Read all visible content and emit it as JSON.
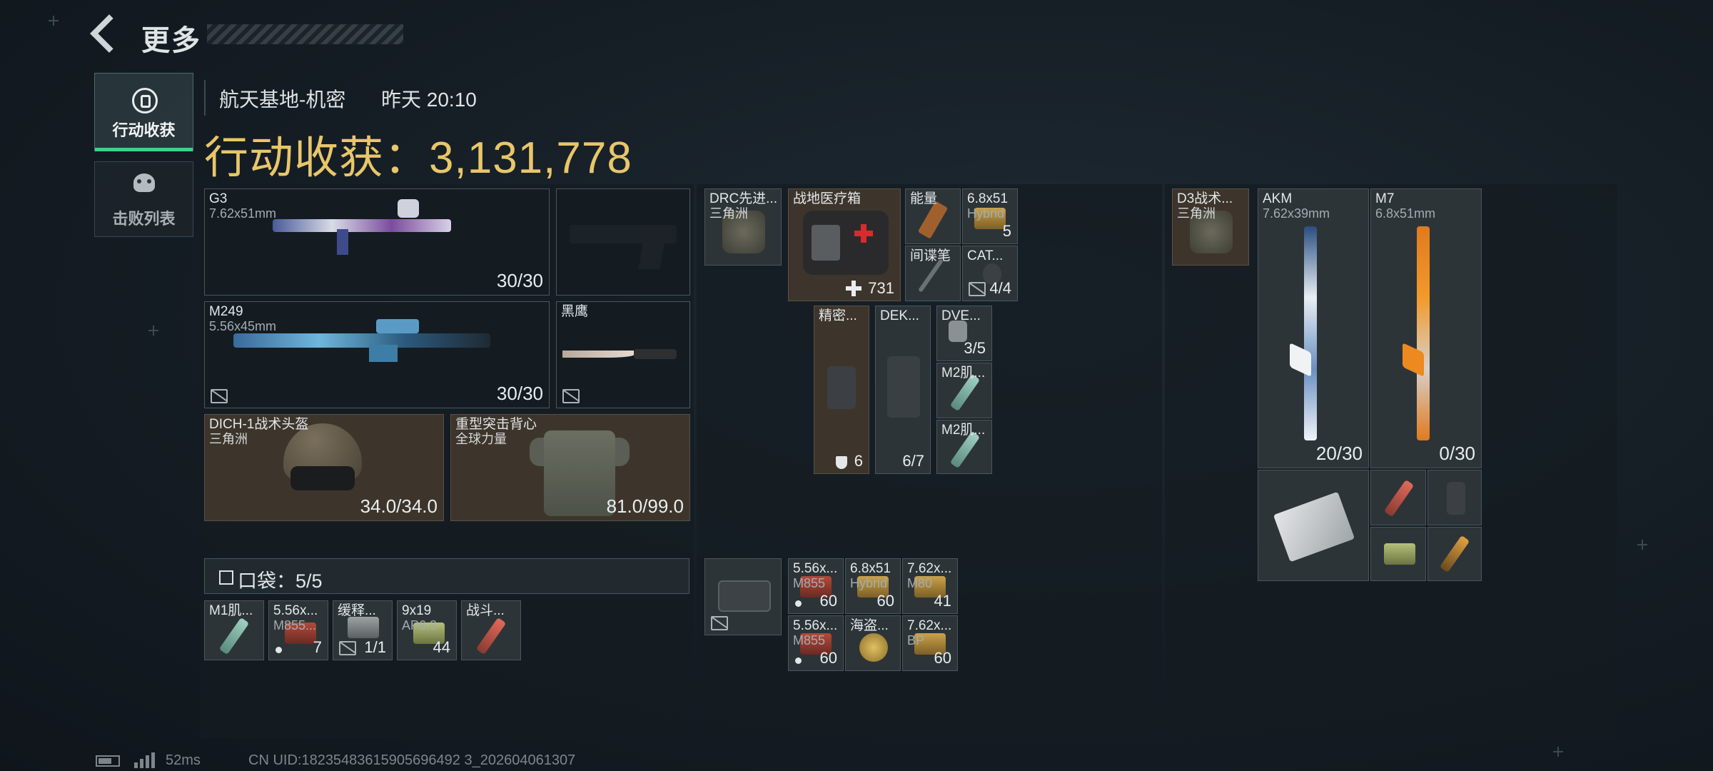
{
  "header": {
    "back_label": "更多",
    "map_name": "航天基地-机密",
    "time": "昨天 20:10",
    "loot_title": "行动收获：3,131,778"
  },
  "nav": {
    "tabs": [
      {
        "label": "行动收获",
        "icon": "loot-icon",
        "active": true
      },
      {
        "label": "击败列表",
        "icon": "skull-icon",
        "active": false
      }
    ]
  },
  "equipment": {
    "g3": {
      "name": "G3",
      "caliber": "7.62x51mm",
      "ammo": "30/30"
    },
    "m249": {
      "name": "M249",
      "caliber": "5.56x45mm",
      "ammo": "30/30"
    },
    "knife": {
      "name": "黑鹰"
    },
    "helmet": {
      "name": "DICH-1战术头盔",
      "brand": "三角洲",
      "durability": "34.0/34.0"
    },
    "armor": {
      "name": "重型突击背心",
      "brand": "全球力量",
      "durability": "81.0/99.0"
    }
  },
  "pocket": {
    "label": "口袋：5/5",
    "items": [
      {
        "name": "M1肌...",
        "sub": "",
        "count": ""
      },
      {
        "name": "5.56x...",
        "sub": "M855...",
        "count": "7"
      },
      {
        "name": "缓释...",
        "sub": "",
        "count": "1/1"
      },
      {
        "name": "9x19",
        "sub": "AP6.3",
        "count": "44"
      },
      {
        "name": "战斗...",
        "sub": "",
        "count": ""
      }
    ]
  },
  "chest_rig": {
    "name": "DRC先进...",
    "brand": "三角洲",
    "items": {
      "medkit": {
        "name": "战地医疗箱",
        "count": "731"
      },
      "energy": {
        "name": "能量"
      },
      "ammo_6851": {
        "name": "6.8x51",
        "sub": "Hybrid",
        "count": "5"
      },
      "spy_pen": {
        "name": "间谍笔"
      },
      "cat": {
        "name": "CAT...",
        "count": "4/4"
      },
      "precision": {
        "name": "精密...",
        "count": "6"
      },
      "dek": {
        "name": "DEK...",
        "count": "6/7"
      },
      "dve": {
        "name": "DVE...",
        "count": "3/5"
      },
      "m2_a": {
        "name": "M2肌..."
      },
      "m2_b": {
        "name": "M2肌..."
      }
    }
  },
  "case_grid": [
    {
      "name": "5.56x...",
      "sub": "M855",
      "count": "60"
    },
    {
      "name": "6.8x51",
      "sub": "Hybrid",
      "count": "60"
    },
    {
      "name": "7.62x...",
      "sub": "M80",
      "count": "41"
    },
    {
      "name": "5.56x...",
      "sub": "M855",
      "count": "60"
    },
    {
      "name": "海盗...",
      "sub": "",
      "count": ""
    },
    {
      "name": "7.62x...",
      "sub": "BP",
      "count": "60"
    }
  ],
  "backpack": {
    "name": "D3战术...",
    "brand": "三角洲",
    "weapons": [
      {
        "name": "AKM",
        "caliber": "7.62x39mm",
        "ammo": "20/30"
      },
      {
        "name": "M7",
        "caliber": "6.8x51mm",
        "ammo": "0/30"
      }
    ]
  },
  "footer": {
    "ping": "52ms",
    "uid": "CN UID:18235483615905696492 3_202604061307"
  },
  "colors": {
    "accent_green": "#3fd08a",
    "title_gold": "#e8c66a",
    "slot_brown": "#3d352b"
  }
}
